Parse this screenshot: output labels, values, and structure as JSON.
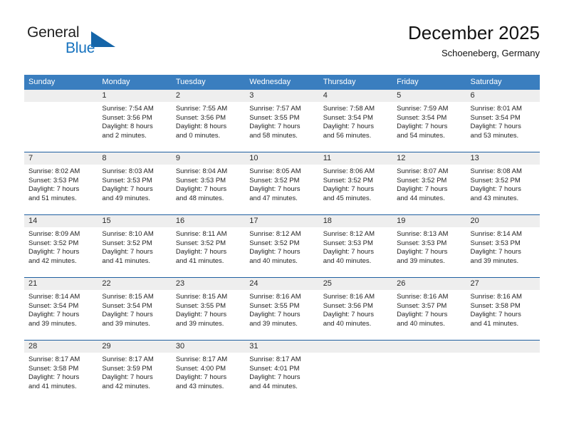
{
  "brand": {
    "word1": "General",
    "word2": "Blue",
    "triangle_color": "#1565a8",
    "blue_text_color": "#1672be"
  },
  "header": {
    "title": "December 2025",
    "subtitle": "Schoeneberg, Germany"
  },
  "theme": {
    "header_row_bg": "#3a7ebf",
    "week_divider": "#1f5fa0",
    "day_number_band": "#eeeeee"
  },
  "weekdays": [
    "Sunday",
    "Monday",
    "Tuesday",
    "Wednesday",
    "Thursday",
    "Friday",
    "Saturday"
  ],
  "weeks": [
    [
      {
        "day": "",
        "sunrise": "",
        "sunset": "",
        "daylight1": "",
        "daylight2": ""
      },
      {
        "day": "1",
        "sunrise": "Sunrise: 7:54 AM",
        "sunset": "Sunset: 3:56 PM",
        "daylight1": "Daylight: 8 hours",
        "daylight2": "and 2 minutes."
      },
      {
        "day": "2",
        "sunrise": "Sunrise: 7:55 AM",
        "sunset": "Sunset: 3:56 PM",
        "daylight1": "Daylight: 8 hours",
        "daylight2": "and 0 minutes."
      },
      {
        "day": "3",
        "sunrise": "Sunrise: 7:57 AM",
        "sunset": "Sunset: 3:55 PM",
        "daylight1": "Daylight: 7 hours",
        "daylight2": "and 58 minutes."
      },
      {
        "day": "4",
        "sunrise": "Sunrise: 7:58 AM",
        "sunset": "Sunset: 3:54 PM",
        "daylight1": "Daylight: 7 hours",
        "daylight2": "and 56 minutes."
      },
      {
        "day": "5",
        "sunrise": "Sunrise: 7:59 AM",
        "sunset": "Sunset: 3:54 PM",
        "daylight1": "Daylight: 7 hours",
        "daylight2": "and 54 minutes."
      },
      {
        "day": "6",
        "sunrise": "Sunrise: 8:01 AM",
        "sunset": "Sunset: 3:54 PM",
        "daylight1": "Daylight: 7 hours",
        "daylight2": "and 53 minutes."
      }
    ],
    [
      {
        "day": "7",
        "sunrise": "Sunrise: 8:02 AM",
        "sunset": "Sunset: 3:53 PM",
        "daylight1": "Daylight: 7 hours",
        "daylight2": "and 51 minutes."
      },
      {
        "day": "8",
        "sunrise": "Sunrise: 8:03 AM",
        "sunset": "Sunset: 3:53 PM",
        "daylight1": "Daylight: 7 hours",
        "daylight2": "and 49 minutes."
      },
      {
        "day": "9",
        "sunrise": "Sunrise: 8:04 AM",
        "sunset": "Sunset: 3:53 PM",
        "daylight1": "Daylight: 7 hours",
        "daylight2": "and 48 minutes."
      },
      {
        "day": "10",
        "sunrise": "Sunrise: 8:05 AM",
        "sunset": "Sunset: 3:52 PM",
        "daylight1": "Daylight: 7 hours",
        "daylight2": "and 47 minutes."
      },
      {
        "day": "11",
        "sunrise": "Sunrise: 8:06 AM",
        "sunset": "Sunset: 3:52 PM",
        "daylight1": "Daylight: 7 hours",
        "daylight2": "and 45 minutes."
      },
      {
        "day": "12",
        "sunrise": "Sunrise: 8:07 AM",
        "sunset": "Sunset: 3:52 PM",
        "daylight1": "Daylight: 7 hours",
        "daylight2": "and 44 minutes."
      },
      {
        "day": "13",
        "sunrise": "Sunrise: 8:08 AM",
        "sunset": "Sunset: 3:52 PM",
        "daylight1": "Daylight: 7 hours",
        "daylight2": "and 43 minutes."
      }
    ],
    [
      {
        "day": "14",
        "sunrise": "Sunrise: 8:09 AM",
        "sunset": "Sunset: 3:52 PM",
        "daylight1": "Daylight: 7 hours",
        "daylight2": "and 42 minutes."
      },
      {
        "day": "15",
        "sunrise": "Sunrise: 8:10 AM",
        "sunset": "Sunset: 3:52 PM",
        "daylight1": "Daylight: 7 hours",
        "daylight2": "and 41 minutes."
      },
      {
        "day": "16",
        "sunrise": "Sunrise: 8:11 AM",
        "sunset": "Sunset: 3:52 PM",
        "daylight1": "Daylight: 7 hours",
        "daylight2": "and 41 minutes."
      },
      {
        "day": "17",
        "sunrise": "Sunrise: 8:12 AM",
        "sunset": "Sunset: 3:52 PM",
        "daylight1": "Daylight: 7 hours",
        "daylight2": "and 40 minutes."
      },
      {
        "day": "18",
        "sunrise": "Sunrise: 8:12 AM",
        "sunset": "Sunset: 3:53 PM",
        "daylight1": "Daylight: 7 hours",
        "daylight2": "and 40 minutes."
      },
      {
        "day": "19",
        "sunrise": "Sunrise: 8:13 AM",
        "sunset": "Sunset: 3:53 PM",
        "daylight1": "Daylight: 7 hours",
        "daylight2": "and 39 minutes."
      },
      {
        "day": "20",
        "sunrise": "Sunrise: 8:14 AM",
        "sunset": "Sunset: 3:53 PM",
        "daylight1": "Daylight: 7 hours",
        "daylight2": "and 39 minutes."
      }
    ],
    [
      {
        "day": "21",
        "sunrise": "Sunrise: 8:14 AM",
        "sunset": "Sunset: 3:54 PM",
        "daylight1": "Daylight: 7 hours",
        "daylight2": "and 39 minutes."
      },
      {
        "day": "22",
        "sunrise": "Sunrise: 8:15 AM",
        "sunset": "Sunset: 3:54 PM",
        "daylight1": "Daylight: 7 hours",
        "daylight2": "and 39 minutes."
      },
      {
        "day": "23",
        "sunrise": "Sunrise: 8:15 AM",
        "sunset": "Sunset: 3:55 PM",
        "daylight1": "Daylight: 7 hours",
        "daylight2": "and 39 minutes."
      },
      {
        "day": "24",
        "sunrise": "Sunrise: 8:16 AM",
        "sunset": "Sunset: 3:55 PM",
        "daylight1": "Daylight: 7 hours",
        "daylight2": "and 39 minutes."
      },
      {
        "day": "25",
        "sunrise": "Sunrise: 8:16 AM",
        "sunset": "Sunset: 3:56 PM",
        "daylight1": "Daylight: 7 hours",
        "daylight2": "and 40 minutes."
      },
      {
        "day": "26",
        "sunrise": "Sunrise: 8:16 AM",
        "sunset": "Sunset: 3:57 PM",
        "daylight1": "Daylight: 7 hours",
        "daylight2": "and 40 minutes."
      },
      {
        "day": "27",
        "sunrise": "Sunrise: 8:16 AM",
        "sunset": "Sunset: 3:58 PM",
        "daylight1": "Daylight: 7 hours",
        "daylight2": "and 41 minutes."
      }
    ],
    [
      {
        "day": "28",
        "sunrise": "Sunrise: 8:17 AM",
        "sunset": "Sunset: 3:58 PM",
        "daylight1": "Daylight: 7 hours",
        "daylight2": "and 41 minutes."
      },
      {
        "day": "29",
        "sunrise": "Sunrise: 8:17 AM",
        "sunset": "Sunset: 3:59 PM",
        "daylight1": "Daylight: 7 hours",
        "daylight2": "and 42 minutes."
      },
      {
        "day": "30",
        "sunrise": "Sunrise: 8:17 AM",
        "sunset": "Sunset: 4:00 PM",
        "daylight1": "Daylight: 7 hours",
        "daylight2": "and 43 minutes."
      },
      {
        "day": "31",
        "sunrise": "Sunrise: 8:17 AM",
        "sunset": "Sunset: 4:01 PM",
        "daylight1": "Daylight: 7 hours",
        "daylight2": "and 44 minutes."
      },
      {
        "day": "",
        "sunrise": "",
        "sunset": "",
        "daylight1": "",
        "daylight2": ""
      },
      {
        "day": "",
        "sunrise": "",
        "sunset": "",
        "daylight1": "",
        "daylight2": ""
      },
      {
        "day": "",
        "sunrise": "",
        "sunset": "",
        "daylight1": "",
        "daylight2": ""
      }
    ]
  ]
}
